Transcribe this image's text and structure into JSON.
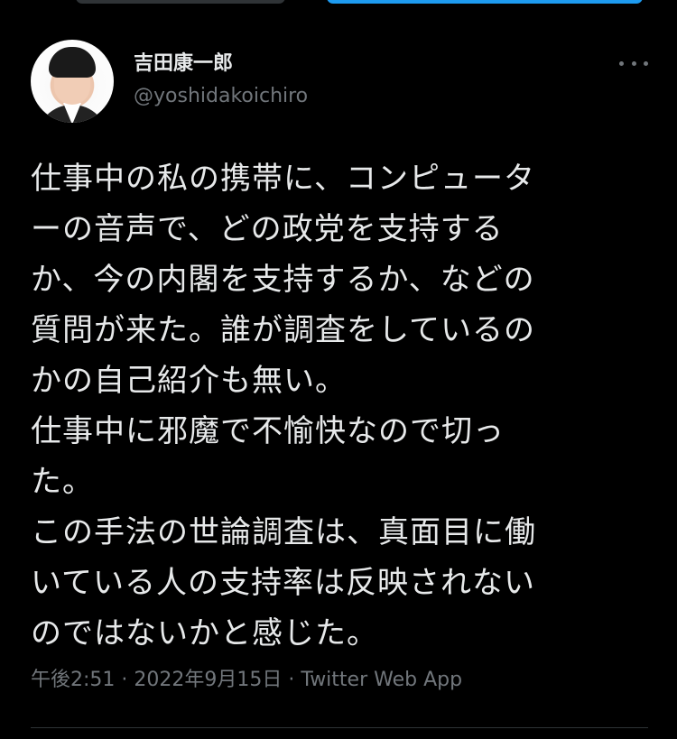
{
  "author": {
    "display_name": "吉田康一郎",
    "handle": "@yoshidakoichiro"
  },
  "tweet": {
    "lines": [
      "仕事中の私の携帯に、コンピュータ",
      "ーの音声で、どの政党を支持する",
      "か、今の内閣を支持するか、などの",
      "質問が来た。誰が調査をしているの",
      "かの自己紹介も無い。",
      "仕事中に邪魔で不愉快なので切っ",
      "た。",
      "この手法の世論調査は、真面目に働",
      "いている人の支持率は反映されない",
      "のではないかと感じた。"
    ]
  },
  "meta": {
    "time": "午後2:51",
    "separator": "·",
    "date": "2022年9月15日",
    "source": "Twitter Web App"
  },
  "icons": {
    "more": "more-horizontal-icon",
    "avatar": "profile-avatar"
  },
  "colors": {
    "background": "#000000",
    "text_primary": "#e7e9ea",
    "text_secondary": "#71767b",
    "divider": "#2f3336",
    "accent": "#1d9bf0"
  }
}
